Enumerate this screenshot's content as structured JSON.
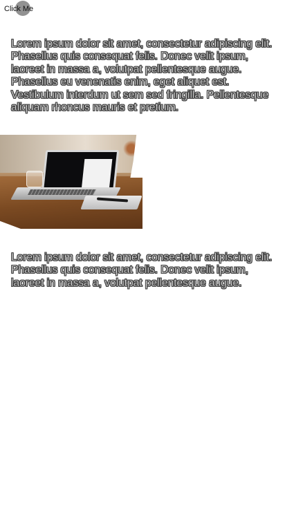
{
  "button": {
    "label": "Click Me"
  },
  "paragraphs": [
    "Lorem ipsum dolor sit amet, consectetur adipiscing elit. Phasellus quis consequat felis. Donec velit ipsum, laoreet in massa a, volutpat pellentesque augue. Phasellus eu venenatis enim, eget aliquet est. Vestibulum interdum ut sem sed fringilla. Pellentesque aliquam rhoncus mauris et pretium.",
    "Lorem ipsum dolor sit amet, consectetur adipiscing elit. Phasellus quis consequat felis. Donec velit ipsum, laoreet in massa a, volutpat pellentesque augue."
  ],
  "image": {
    "subject": "laptop-on-wooden-desk"
  }
}
